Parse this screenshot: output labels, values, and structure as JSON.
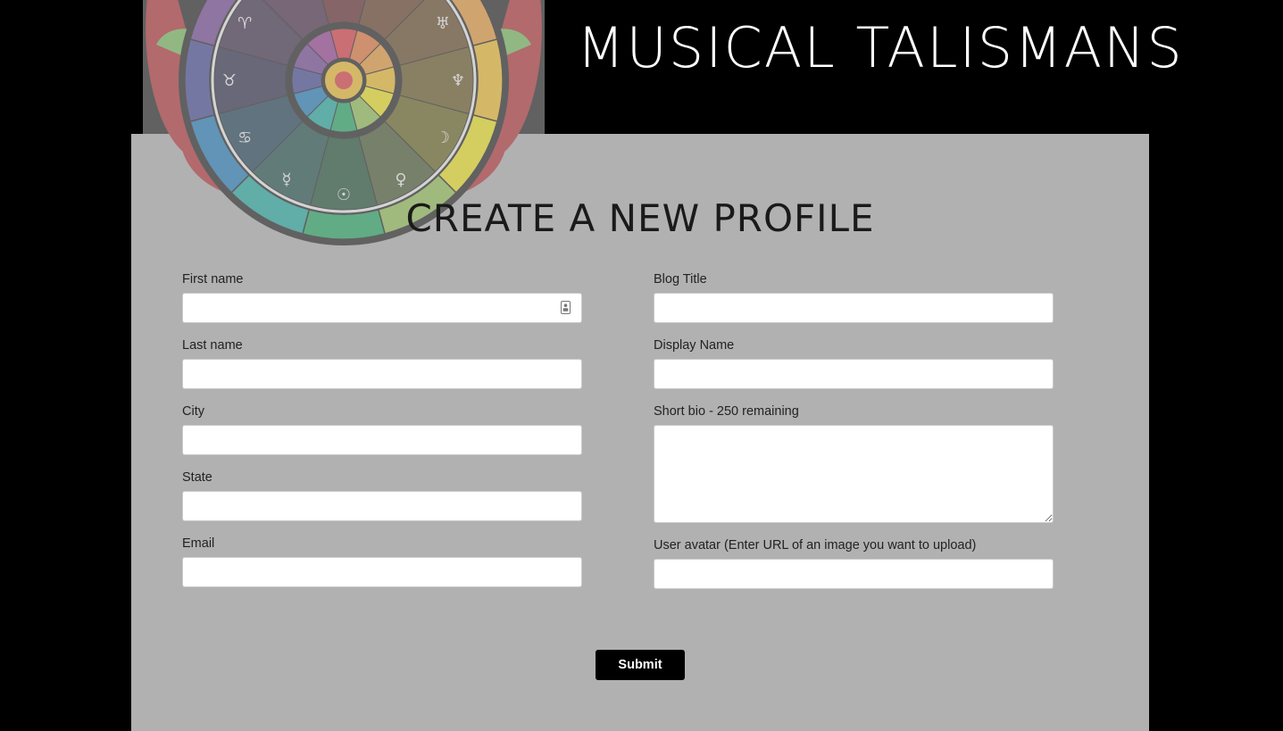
{
  "header": {
    "site_title": "MUSICAL TALISMANS"
  },
  "form": {
    "heading": "CREATE A NEW PROFILE",
    "fields": {
      "first_name": {
        "label": "First name",
        "value": ""
      },
      "last_name": {
        "label": "Last name",
        "value": ""
      },
      "city": {
        "label": "City",
        "value": ""
      },
      "state": {
        "label": "State",
        "value": ""
      },
      "email": {
        "label": "Email",
        "value": ""
      },
      "blog_title": {
        "label": "Blog Title",
        "value": ""
      },
      "display_name": {
        "label": "Display Name",
        "value": ""
      },
      "short_bio": {
        "label": "Short bio - 250 remaining",
        "value": ""
      },
      "user_avatar": {
        "label": "User avatar (Enter URL of an image you want to upload)",
        "value": ""
      }
    },
    "submit_label": "Submit"
  },
  "logo": {
    "wheel_colors": [
      "#e8202a",
      "#f2681f",
      "#f7941d",
      "#ffc20e",
      "#fff200",
      "#8dc63f",
      "#00a651",
      "#00a99d",
      "#0072bc",
      "#2e3192",
      "#662d91",
      "#92278f"
    ],
    "wheel_symbols": [
      "♃",
      "♄",
      "♅",
      "♆",
      "☽",
      "♀",
      "☉",
      "☿",
      "♋",
      "♉",
      "♈",
      "♒"
    ],
    "leaf_color": "#6cc24a",
    "rose_color": "#b3141c"
  },
  "icons": {
    "first_name_autofill": "contact-card-icon"
  }
}
